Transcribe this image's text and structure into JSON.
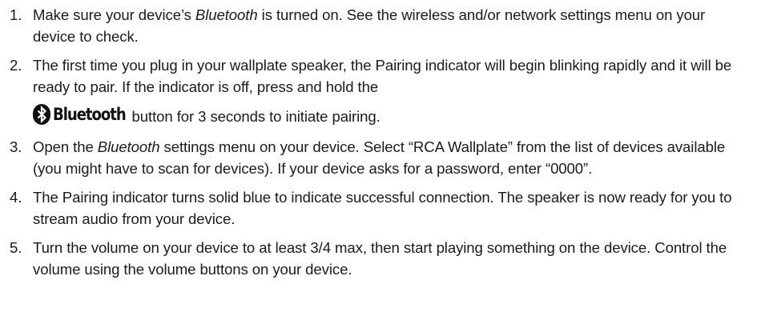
{
  "steps": [
    {
      "number": "1.",
      "p1": "Make sure your device’s ",
      "em": "Bluetooth",
      "p2": " is turned on. See the wireless and/or network settings menu on your device to check."
    },
    {
      "number": "2.",
      "text": "The first time you plug in your wallplate speaker, the Pairing indicator will begin blinking rapidly and it will be ready to pair. If the indicator is off, press and hold the",
      "button_label": "Bluetooth",
      "button_icon": "bluetooth-icon",
      "after": " button for 3 seconds to initiate pairing."
    },
    {
      "number": "3.",
      "p1": "Open the ",
      "em": "Bluetooth",
      "p2": " settings menu on your device. Select “RCA Wallplate” from the list of devices available (you might have to scan for devices). If your device asks for a password, enter “0000”."
    },
    {
      "number": "4.",
      "text": "The Pairing indicator turns solid blue to indicate successful connection. The speaker is now ready for you to stream audio from your device."
    },
    {
      "number": "5.",
      "text": "Turn the volume on your device to at least 3/4 max, then start playing something on the device. Control the volume using the volume buttons on your device."
    }
  ]
}
